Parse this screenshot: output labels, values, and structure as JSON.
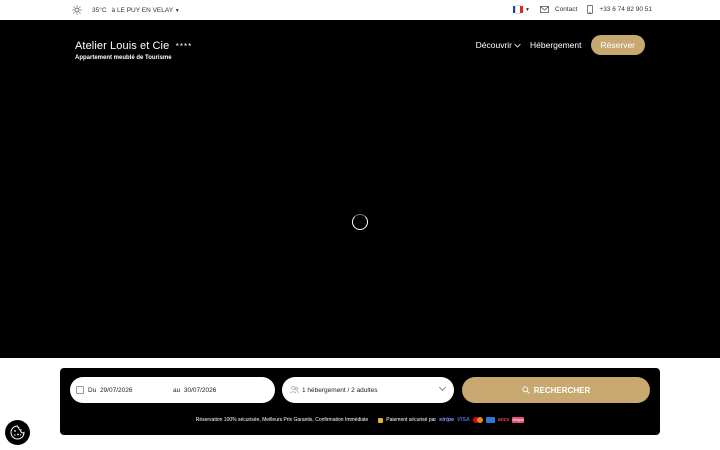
{
  "topbar": {
    "weather": "35°C",
    "location": "à LE PUY EN VELAY",
    "contact_label": "Contact",
    "phone": "+33 6 74 82 90 51",
    "language_flag": "fr-flag-icon"
  },
  "header": {
    "brand_name": "Atelier Louis et Cie",
    "brand_stars": "****",
    "brand_subtitle": "Appartement meublé de Tourisme",
    "nav": [
      {
        "label": "Découvrir"
      },
      {
        "label": "Hébergement"
      }
    ],
    "reserve_label": "Réserver"
  },
  "booking": {
    "from_prefix": "Du",
    "from_date": "29/07/2026",
    "to_prefix": "au",
    "to_date": "30/07/2026",
    "guests": "1 hébergement / 2 adultes",
    "search_label": "RECHERCHER",
    "reassurance": "Réservation 100% sécurisée, Meilleurs Prix Garantis, Confirmation Immédiate",
    "payment_label": "Paiement sécurisé par",
    "stripe": "stripe",
    "visa": "VISA",
    "ancv": "ancv",
    "cheque": "chèque"
  },
  "colors": {
    "accent": "#c6a870",
    "hero_bg": "#000000",
    "flag_blue": "#1f3fa6",
    "flag_white": "#ffffff",
    "flag_red": "#e1262d",
    "mc_red": "#eb001b",
    "mc_yellow": "#f79e1b"
  }
}
